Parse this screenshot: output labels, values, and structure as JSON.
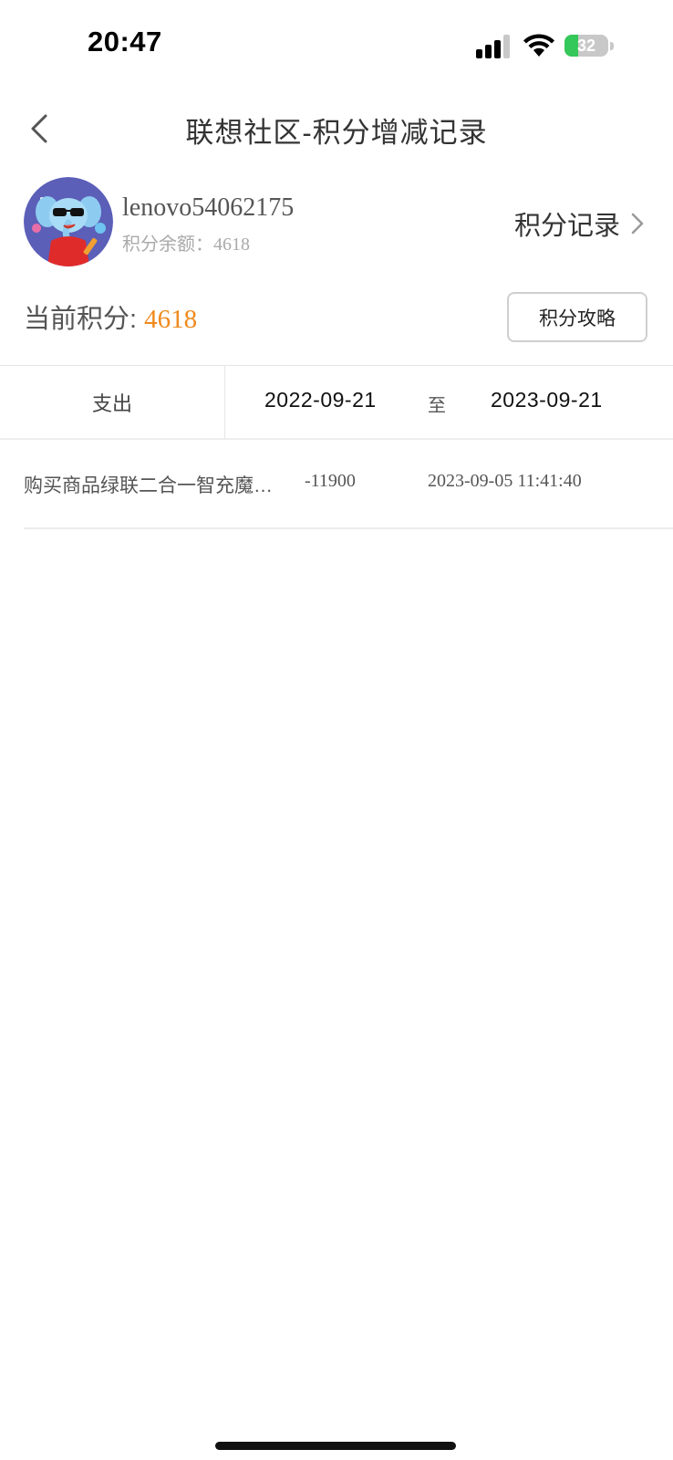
{
  "status_bar": {
    "time": "20:47",
    "battery": "32",
    "battery_level": 0.32,
    "icons": [
      "cellular-signal-icon",
      "wifi-icon",
      "battery-charging-icon"
    ]
  },
  "nav": {
    "title": "联想社区-积分增减记录",
    "back_icon": "chevron-left-icon"
  },
  "profile": {
    "username": "lenovo54062175",
    "balance_label": "积分余额：",
    "balance_value": "4618",
    "record_link": "积分记录",
    "avatar_icon": "elephant-mascot-avatar"
  },
  "points": {
    "current_label": "当前积分: ",
    "current_value": "4618",
    "strategy_button": "积分攻略"
  },
  "filter": {
    "type": "支出",
    "date_start": "2022-09-21",
    "to_label": "至",
    "date_end": "2023-09-21"
  },
  "records": [
    {
      "description": "购买商品绿联二合一智充魔…",
      "amount": "-11900",
      "time": "2023-09-05 11:41:40"
    }
  ],
  "colors": {
    "accent": "#f08a1c",
    "battery_green": "#34c759"
  }
}
